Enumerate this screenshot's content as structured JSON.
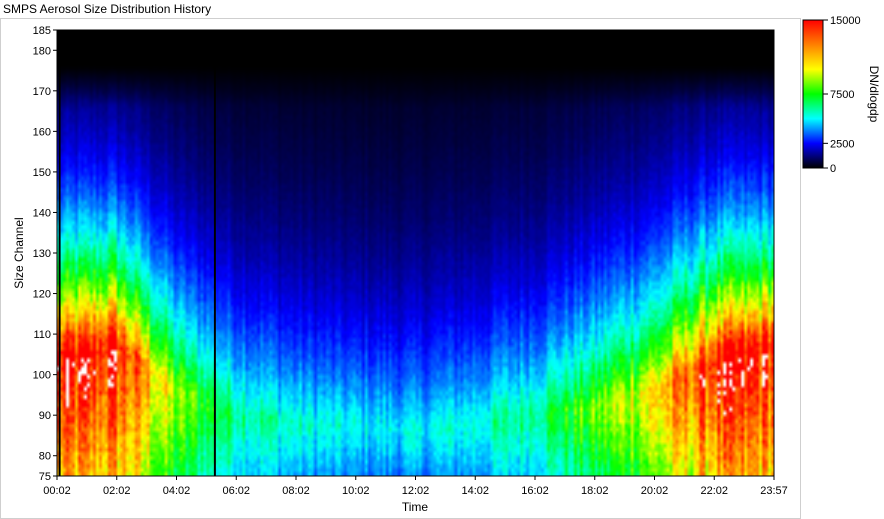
{
  "window": {
    "title": "SMPS Aerosol Size Distribution History"
  },
  "chart_data": {
    "type": "heatmap",
    "title": "SMPS Aerosol Size Distribution History",
    "xlabel": "Time",
    "ylabel": "Size Channel",
    "x_ticks": [
      "00:02",
      "02:02",
      "04:02",
      "06:02",
      "08:02",
      "10:02",
      "12:02",
      "14:02",
      "16:02",
      "18:02",
      "20:02",
      "22:02",
      "23:57"
    ],
    "x_range": [
      "00:02",
      "23:57"
    ],
    "y_ticks": [
      75,
      80,
      90,
      100,
      110,
      120,
      130,
      140,
      150,
      160,
      170,
      180,
      185
    ],
    "y_range": [
      75,
      185
    ],
    "colorbar": {
      "label": "DN/dlogdp",
      "ticks": [
        0,
        2500,
        7500,
        15000
      ],
      "range": [
        0,
        15000
      ],
      "colors": [
        "#000000",
        "#0000ff",
        "#00ffff",
        "#00ff00",
        "#ffff00",
        "#ff8000",
        "#ff0000"
      ]
    },
    "background_above_range": "#ffffff",
    "vertical_gap_lines_hours": [
      0.12,
      5.3
    ],
    "description_rows": [
      {
        "time_hour": 0,
        "ridge_channel": 105,
        "peak": 15000
      },
      {
        "time_hour": 2,
        "ridge_channel": 108,
        "peak": 15000
      },
      {
        "time_hour": 4,
        "ridge_channel": 96,
        "peak": 9000
      },
      {
        "time_hour": 6,
        "ridge_channel": 90,
        "peak": 6500
      },
      {
        "time_hour": 8,
        "ridge_channel": 88,
        "peak": 5500
      },
      {
        "time_hour": 10,
        "ridge_channel": 88,
        "peak": 5000
      },
      {
        "time_hour": 12,
        "ridge_channel": 86,
        "peak": 5000
      },
      {
        "time_hour": 14,
        "ridge_channel": 88,
        "peak": 5500
      },
      {
        "time_hour": 16,
        "ridge_channel": 90,
        "peak": 6500
      },
      {
        "time_hour": 18,
        "ridge_channel": 92,
        "peak": 8500
      },
      {
        "time_hour": 20,
        "ridge_channel": 96,
        "peak": 11000
      },
      {
        "time_hour": 22,
        "ridge_channel": 104,
        "peak": 15000
      },
      {
        "time_hour": 23.95,
        "ridge_channel": 108,
        "peak": 15000
      }
    ]
  }
}
